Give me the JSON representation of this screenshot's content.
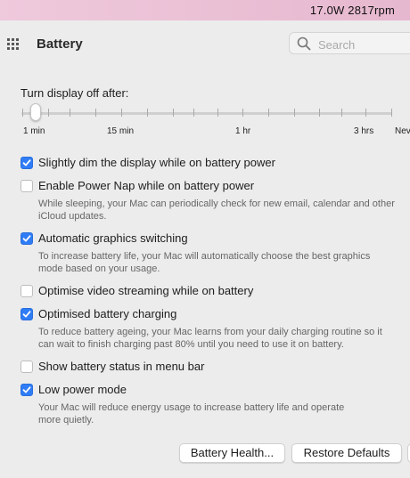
{
  "menubar": {
    "status": "17.0W 2817rpm"
  },
  "header": {
    "title": "Battery",
    "search_placeholder": "Search"
  },
  "slider": {
    "label": "Turn display off after:",
    "value": "1 min",
    "tick_labels": [
      "1 min",
      "15 min",
      "1 hr",
      "3 hrs",
      "Never"
    ]
  },
  "options": [
    {
      "label": "Slightly dim the display while on battery power",
      "checked": true,
      "description": ""
    },
    {
      "label": "Enable Power Nap while on battery power",
      "checked": false,
      "description": "While sleeping, your Mac can periodically check for new email, calendar and other\niCloud updates."
    },
    {
      "label": "Automatic graphics switching",
      "checked": true,
      "description": "To increase battery life, your Mac will automatically choose the best graphics\nmode based on your usage."
    },
    {
      "label": "Optimise video streaming while on battery",
      "checked": false,
      "description": ""
    },
    {
      "label": "Optimised battery charging",
      "checked": true,
      "description": "To reduce battery ageing, your Mac learns from your daily charging routine so it\ncan wait to finish charging past 80% until you need to use it on battery."
    },
    {
      "label": "Show battery status in menu bar",
      "checked": false,
      "description": ""
    },
    {
      "label": "Low power mode",
      "checked": true,
      "description": "Your Mac will reduce energy usage to increase battery life and operate\nmore quietly."
    }
  ],
  "buttons": {
    "battery_health": "Battery Health...",
    "restore_defaults": "Restore Defaults"
  },
  "colors": {
    "accent": "#2f7cf6",
    "menubar": "#efc9dc"
  }
}
